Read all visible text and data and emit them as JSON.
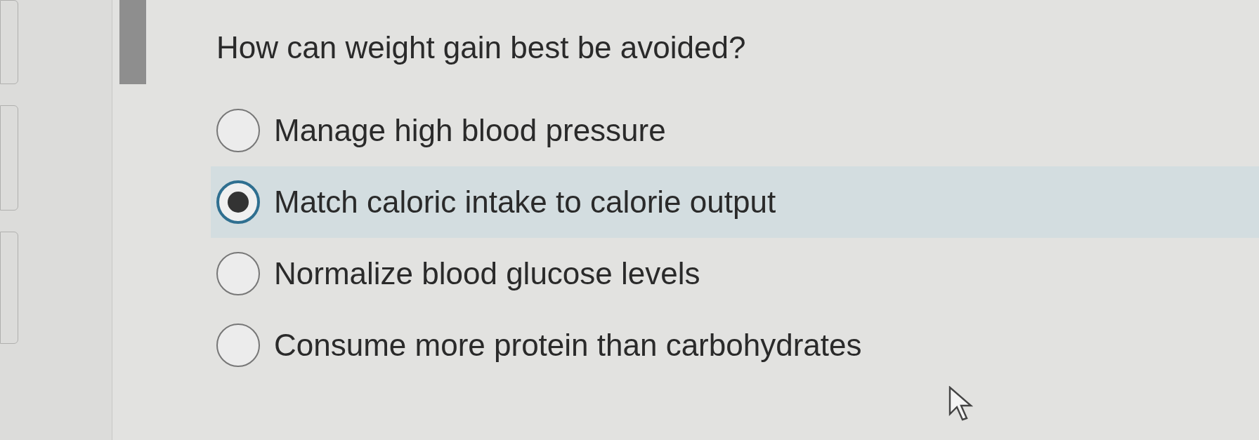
{
  "question": "How can weight gain best be avoided?",
  "options": [
    {
      "label": "Manage high blood pressure",
      "selected": false
    },
    {
      "label": "Match caloric intake to calorie output",
      "selected": true
    },
    {
      "label": "Normalize blood glucose levels",
      "selected": false
    },
    {
      "label": "Consume more protein than carbohydrates",
      "selected": false
    }
  ]
}
